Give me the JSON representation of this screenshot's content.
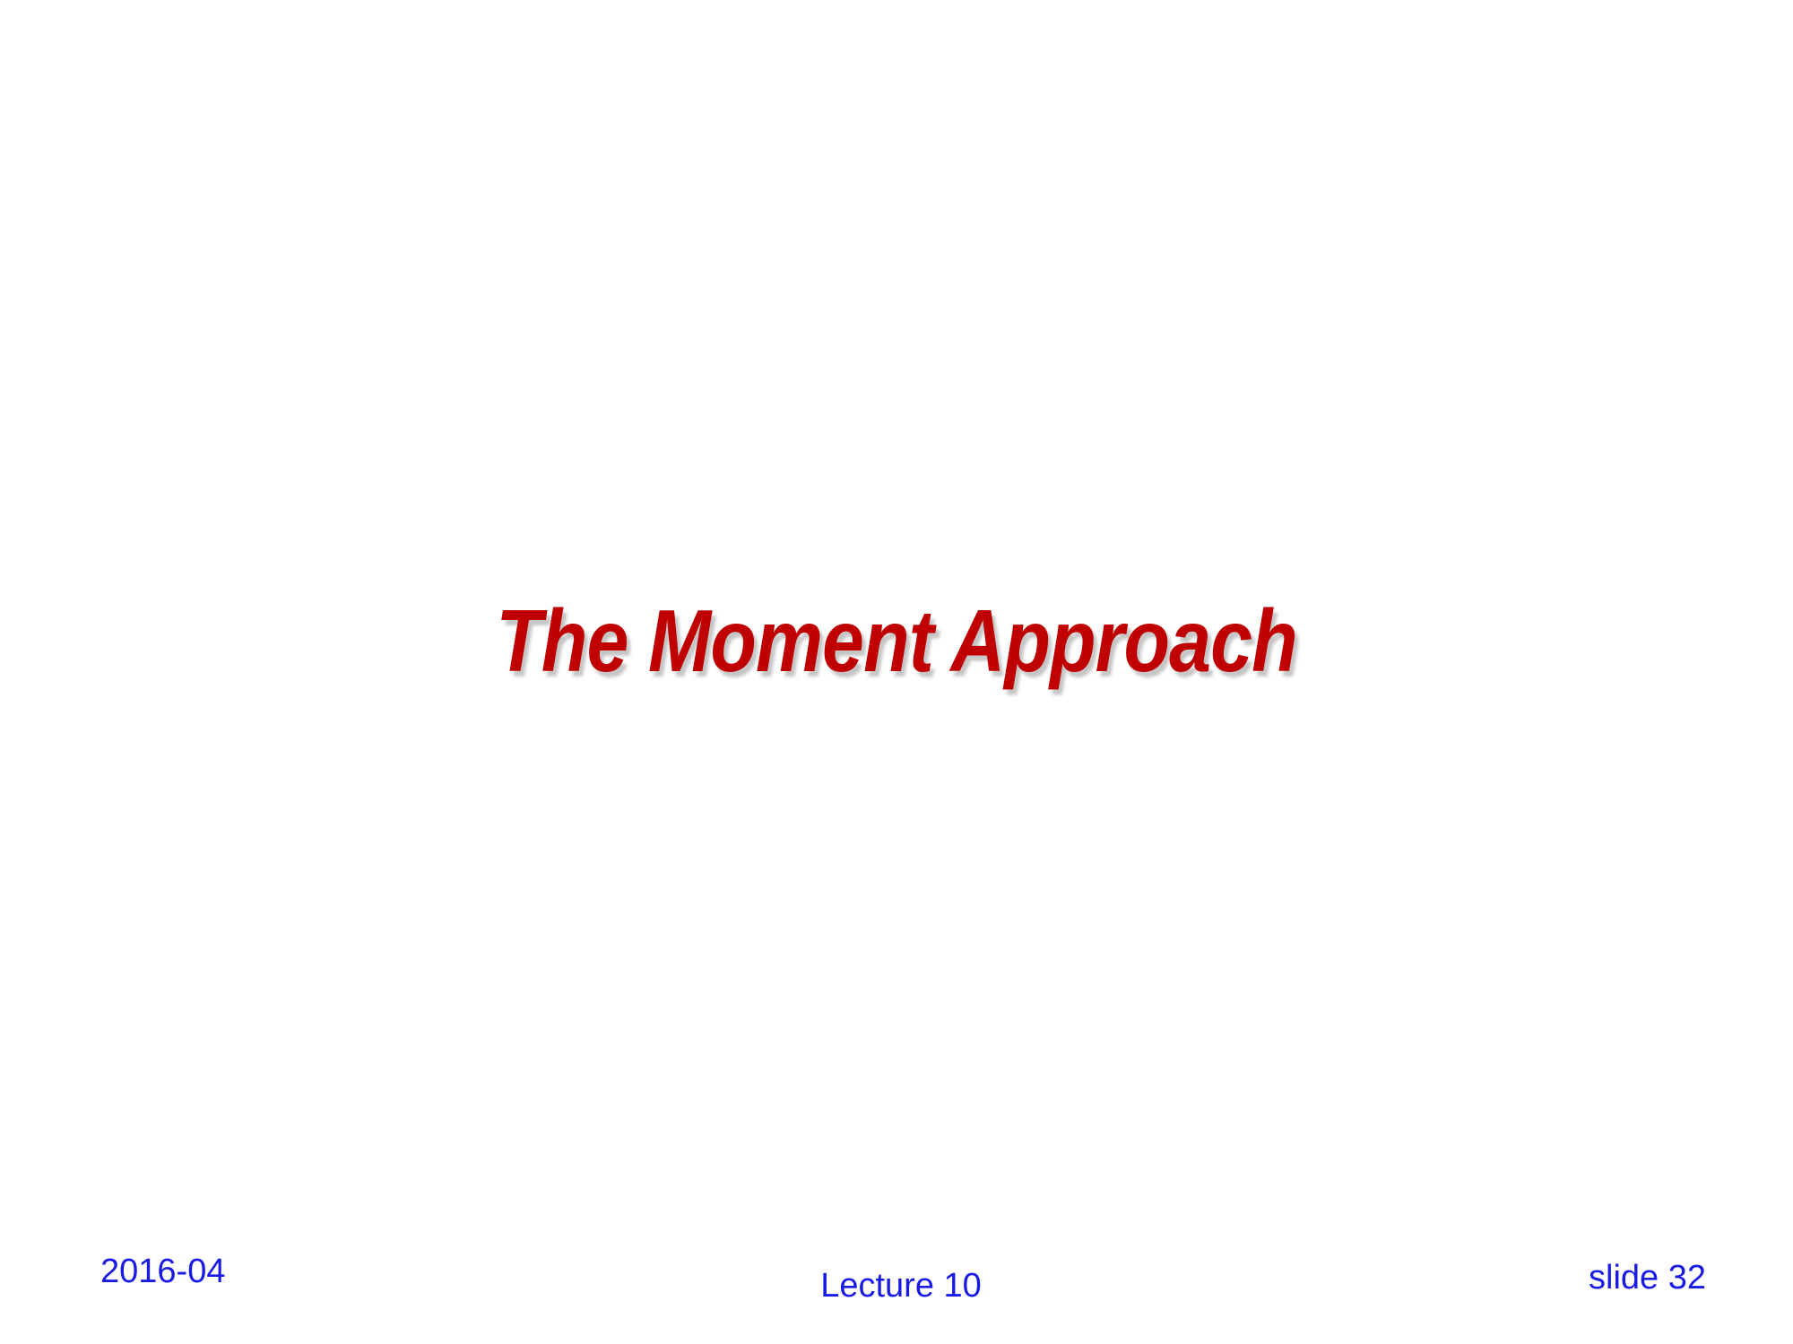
{
  "slide": {
    "title": "The Moment Approach",
    "title_color": "#c00000"
  },
  "footer": {
    "date": "2016-04",
    "lecture": "Lecture 10",
    "slide_number": "slide 32",
    "text_color": "#1a1ae6"
  }
}
